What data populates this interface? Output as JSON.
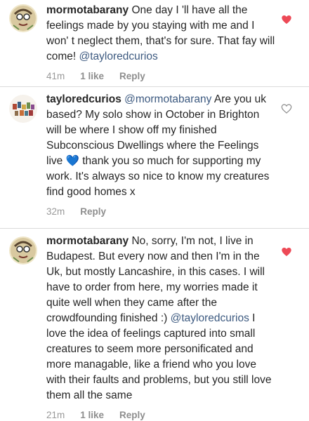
{
  "comments": [
    {
      "username": "mormotabarany",
      "text": " One day I 'll have all the feelings made by you staying with me and I won' t neglect them, that's for sure. That fay will come! ",
      "mention": "@tayloredcurios",
      "time": "41m",
      "likes": "1 like",
      "reply": "Reply",
      "liked": true,
      "heart_color": "#ed4956"
    },
    {
      "username": "tayloredcurios",
      "mention_start": " @mormotabarany",
      "text": " Are you uk based? My solo show in October in Brighton will be where I show off my finished Subconscious Dwellings where the Feelings live ",
      "emoji": "💙",
      "text_after": " thank you so much for supporting my work. It's always so nice to know my creatures find good homes x",
      "time": "32m",
      "reply": "Reply",
      "liked": false
    },
    {
      "username": "mormotabarany",
      "text": " No, sorry, I'm not, I live in Budapest. But every now and then I'm in the Uk, but mostly Lancashire, in this cases. I will have to order from here, my worries made it quite well when they came after the crowdfounding finished :) ",
      "mention": "@tayloredcurios",
      "text_after": "  I love the idea of feelings captured into small creatures to seem more personificated and more managable, like a friend who you love with their faults and problems, but you still love them all the same",
      "time": "21m",
      "likes": "1 like",
      "reply": "Reply",
      "liked": true,
      "heart_color": "#ed4956"
    }
  ]
}
